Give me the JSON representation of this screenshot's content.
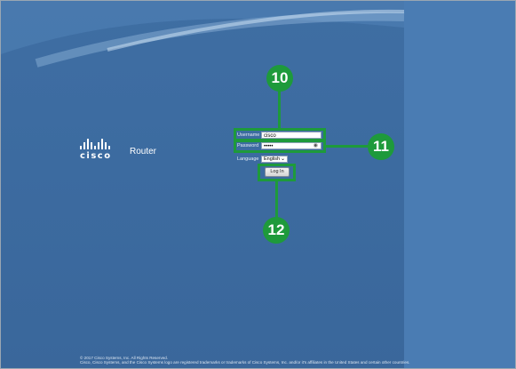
{
  "brand": {
    "logo_text": "cisco",
    "product": "Router"
  },
  "login_form": {
    "username_label": "Username",
    "username_value": "cisco",
    "password_label": "Password",
    "password_value": "•••••",
    "language_label": "Language",
    "language_value": "English",
    "login_button": "Log In"
  },
  "callouts": {
    "username_step": "10",
    "password_step": "11",
    "login_step": "12"
  },
  "colors": {
    "callout_green": "#1e9a3b",
    "background_blue": "#3c6ba0"
  },
  "footer": {
    "line1": "© 2017 Cisco Systems, Inc. All Rights Reserved.",
    "line2": "Cisco, Cisco Systems, and the Cisco Systems logo are registered trademarks or trademarks of Cisco Systems, Inc. and/or it's affiliates in the United States and certain other countries."
  }
}
